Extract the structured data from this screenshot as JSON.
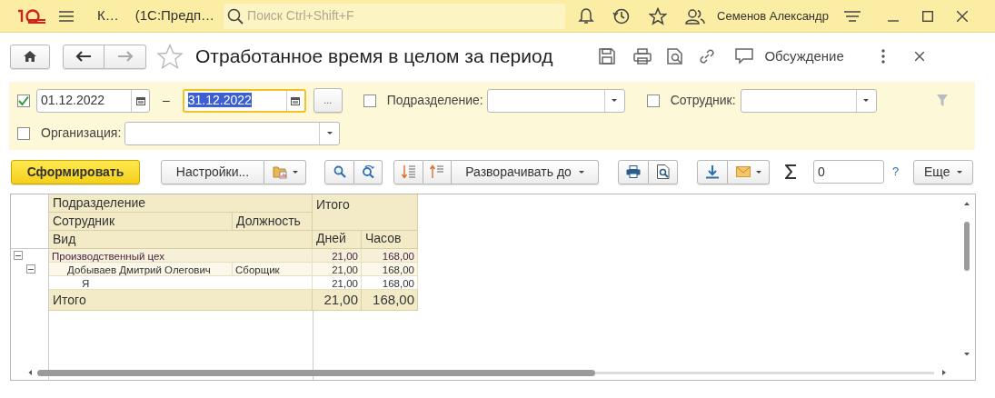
{
  "app": {
    "section": "К…",
    "title": "(1С:Предп…",
    "search_placeholder": "Поиск Ctrl+Shift+F",
    "user": "Семенов Александр"
  },
  "form": {
    "title": "Отработанное время в целом за период",
    "discussion": "Обсуждение"
  },
  "filters": {
    "period": {
      "checked": true,
      "from": "01.12.2022",
      "dash": "–",
      "to": "31.12.2022",
      "more": "..."
    },
    "department": {
      "checked": false,
      "label": "Подразделение:"
    },
    "employee": {
      "checked": false,
      "label": "Сотрудник:"
    },
    "organization": {
      "checked": false,
      "label": "Организация:"
    }
  },
  "toolbar": {
    "generate": "Сформировать",
    "settings": "Настройки...",
    "expand_to": "Разворачивать до",
    "sum_value": "0",
    "help": "?",
    "more": "Еще"
  },
  "report": {
    "header": {
      "department": "Подразделение",
      "total": "Итого",
      "employee": "Сотрудник",
      "position": "Должность",
      "kind": "Вид",
      "days": "Дней",
      "hours": "Часов"
    },
    "rows": [
      {
        "name": "Производственный цех",
        "days": "21,00",
        "hours": "168,00",
        "expanded": true,
        "children": [
          {
            "name": "Добываев Дмитрий Олегович",
            "position": "Сборщик",
            "days": "21,00",
            "hours": "168,00",
            "expanded": true,
            "children": [
              {
                "name": "Я",
                "days": "21,00",
                "hours": "168,00"
              }
            ]
          }
        ]
      }
    ],
    "total": {
      "label": "Итого",
      "days": "21,00",
      "hours": "168,00"
    }
  }
}
